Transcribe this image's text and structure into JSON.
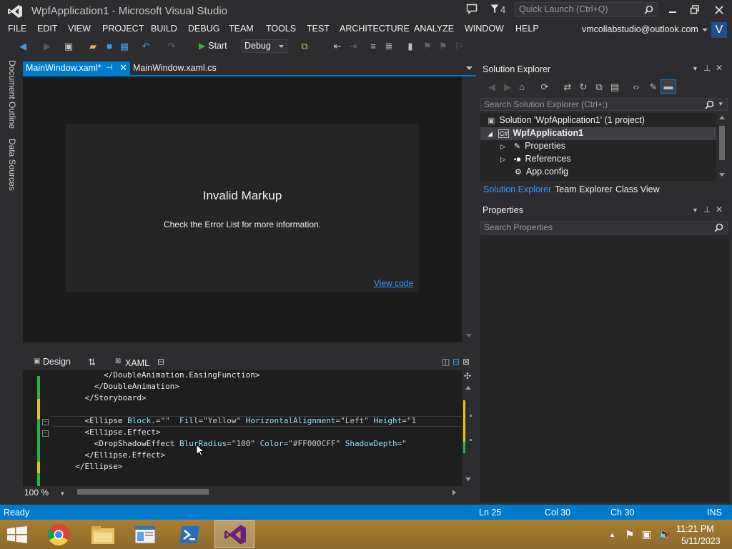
{
  "window": {
    "title": "WpfApplication1 - Microsoft Visual Studio",
    "notification_count": "4",
    "quick_launch_placeholder": "Quick Launch (Ctrl+Q)"
  },
  "menu": [
    "FILE",
    "EDIT",
    "VIEW",
    "PROJECT",
    "BUILD",
    "DEBUG",
    "TEAM",
    "TOOLS",
    "TEST",
    "ARCHITECTURE",
    "ANALYZE",
    "WINDOW",
    "HELP"
  ],
  "account": {
    "email": "vmcollabstudio@outlook.com",
    "avatar": "V"
  },
  "toolbar": {
    "start_label": "Start",
    "configuration": "Debug"
  },
  "side_tabs": [
    "Document Outline",
    "Data Sources"
  ],
  "doc_tabs": [
    {
      "label": "MainWindow.xaml*",
      "active": true
    },
    {
      "label": "MainWindow.xaml.cs",
      "active": false
    }
  ],
  "designer": {
    "title": "Invalid Markup",
    "message": "Check the Error List for more information.",
    "link": "View code"
  },
  "split": {
    "design_tab": "Design",
    "xaml_tab": "XAML"
  },
  "code_lines": [
    {
      "indent": "        ",
      "parts": [
        [
          "tag",
          "</DoubleAnimation.EasingFunction>"
        ]
      ]
    },
    {
      "indent": "      ",
      "parts": [
        [
          "tag",
          "</DoubleAnimation>"
        ]
      ]
    },
    {
      "indent": "    ",
      "parts": [
        [
          "tag",
          "</Storyboard>"
        ]
      ]
    },
    {
      "indent": "",
      "parts": []
    },
    {
      "indent": "    ",
      "parts": [
        [
          "tag",
          "<Ellipse "
        ],
        [
          "attr",
          "Block."
        ],
        [
          "str",
          "=\"\"  "
        ],
        [
          "attr",
          "Fill"
        ],
        [
          "str",
          "=\"Yellow\" "
        ],
        [
          "attr",
          "HorizontalAlignment"
        ],
        [
          "str",
          "=\"Left\" "
        ],
        [
          "attr",
          "Height"
        ],
        [
          "str",
          "=\"1"
        ]
      ]
    },
    {
      "indent": "    ",
      "parts": [
        [
          "tag",
          "<Ellipse.Effect>"
        ]
      ]
    },
    {
      "indent": "      ",
      "parts": [
        [
          "tag",
          "<DropShadowEffect "
        ],
        [
          "attr",
          "BlurRadius"
        ],
        [
          "str",
          "=\"100\" "
        ],
        [
          "attr",
          "Color"
        ],
        [
          "str",
          "=\"#FF000CFF\" "
        ],
        [
          "attr",
          "ShadowDepth"
        ],
        [
          "str",
          "=\""
        ]
      ]
    },
    {
      "indent": "    ",
      "parts": [
        [
          "tag",
          "</Ellipse.Effect>"
        ]
      ]
    },
    {
      "indent": "  ",
      "parts": [
        [
          "tag",
          "</Ellipse>"
        ]
      ]
    }
  ],
  "editor": {
    "zoom": "100 %"
  },
  "solution_explorer": {
    "title": "Solution Explorer",
    "search_placeholder": "Search Solution Explorer (Ctrl+;)",
    "tree": [
      {
        "label": "Solution 'WpfApplication1' (1 project)",
        "depth": 0,
        "icon": "solution-icon",
        "selected": false
      },
      {
        "label": "WpfApplication1",
        "depth": 1,
        "icon": "csharp-project-icon",
        "selected": true
      },
      {
        "label": "Properties",
        "depth": 2,
        "icon": "wrench-icon",
        "selected": false
      },
      {
        "label": "References",
        "depth": 2,
        "icon": "references-icon",
        "selected": false
      },
      {
        "label": "App.config",
        "depth": 2,
        "icon": "config-icon",
        "selected": false
      }
    ],
    "bottom_tabs": [
      "Solution Explorer",
      "Team Explorer",
      "Class View"
    ]
  },
  "properties": {
    "title": "Properties",
    "search_placeholder": "Search Properties"
  },
  "status": {
    "ready": "Ready",
    "line": "Ln 25",
    "col": "Col 30",
    "ch": "Ch 30",
    "mode": "INS"
  },
  "clock": {
    "time": "11:21 PM",
    "date": "5/11/2023"
  },
  "colors": {
    "accent": "#007acc",
    "background": "#2d2d30",
    "editor": "#1e1e1e",
    "start_green": "#2fba3f"
  }
}
